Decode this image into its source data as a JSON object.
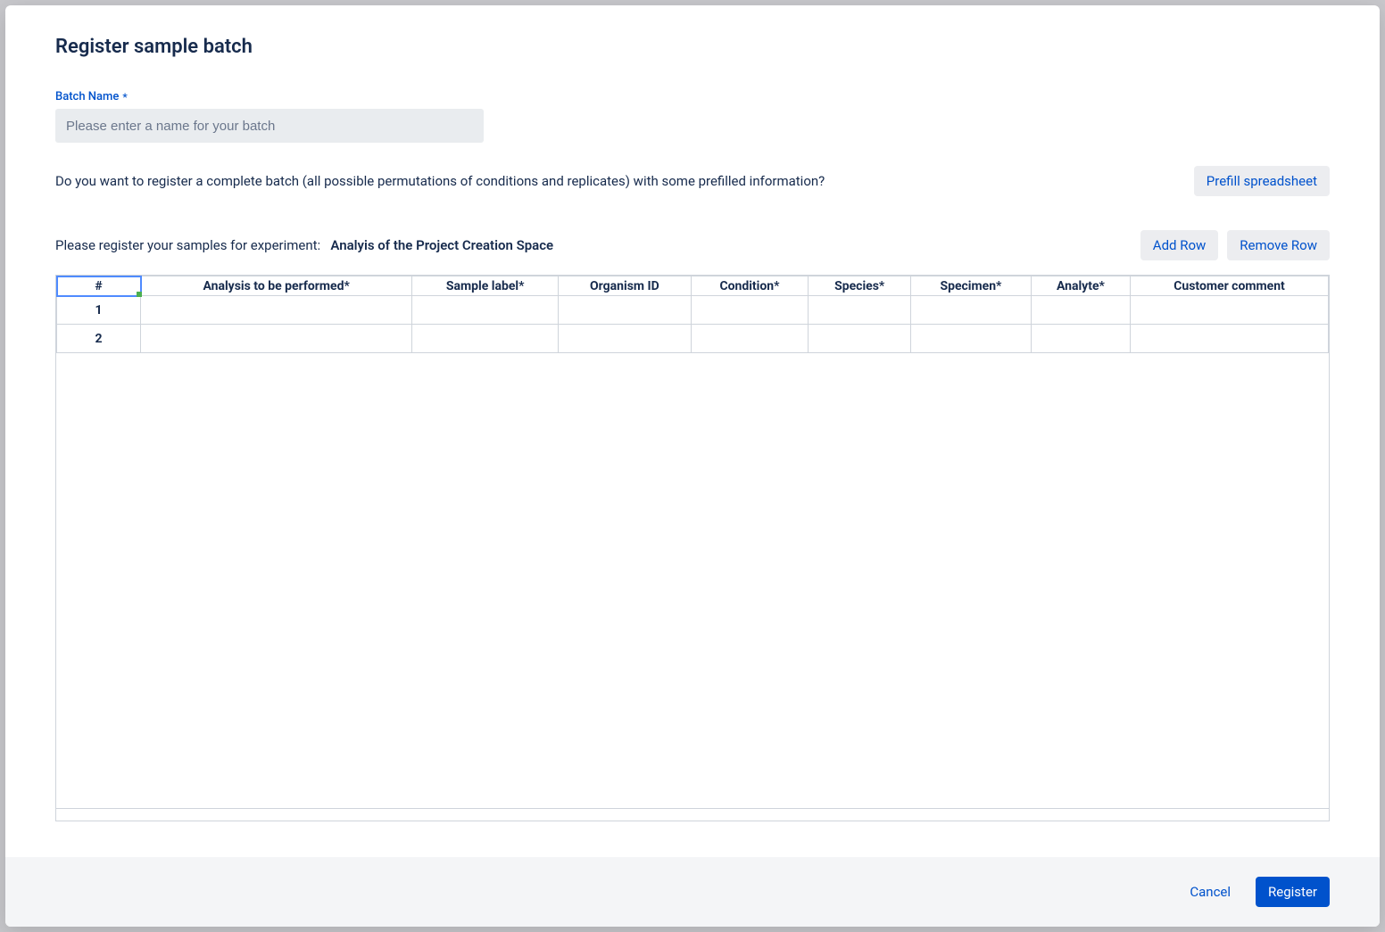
{
  "modal": {
    "title": "Register sample batch"
  },
  "batchName": {
    "label": "Batch Name",
    "required_marker": "*",
    "placeholder": "Please enter a name for your batch",
    "value": ""
  },
  "prefill": {
    "prompt": "Do you want to register a complete batch (all possible permutations of conditions and replicates) with some prefilled information?",
    "button": "Prefill spreadsheet"
  },
  "registerSamples": {
    "prompt": "Please register your samples for experiment:",
    "experiment": "Analyis of the Project Creation Space",
    "addRow": "Add Row",
    "removeRow": "Remove Row"
  },
  "table": {
    "headers": {
      "hash": "#",
      "analysis": "Analysis to be performed*",
      "label": "Sample label*",
      "organism": "Organism ID",
      "condition": "Condition*",
      "species": "Species*",
      "specimen": "Specimen*",
      "analyte": "Analyte*",
      "comment": "Customer comment"
    },
    "rows": [
      {
        "num": "1",
        "analysis": "",
        "label": "",
        "organism": "",
        "condition": "",
        "species": "",
        "specimen": "",
        "analyte": "",
        "comment": ""
      },
      {
        "num": "2",
        "analysis": "",
        "label": "",
        "organism": "",
        "condition": "",
        "species": "",
        "specimen": "",
        "analyte": "",
        "comment": ""
      }
    ]
  },
  "footer": {
    "cancel": "Cancel",
    "register": "Register"
  }
}
